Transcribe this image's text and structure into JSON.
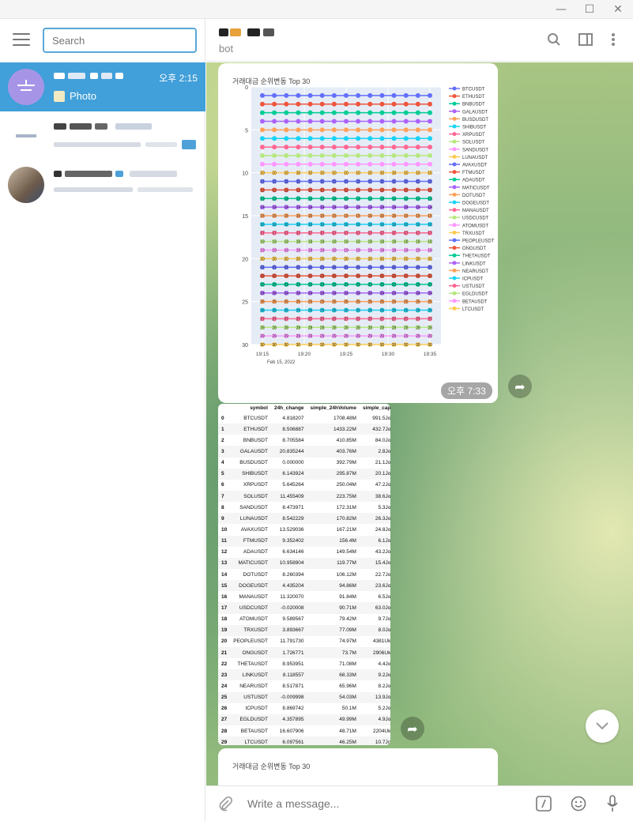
{
  "window": {
    "minimize_glyph": "—",
    "maximize_glyph": "☐",
    "close_glyph": "✕"
  },
  "sidebar": {
    "search_placeholder": "Search",
    "chats": [
      {
        "name_redacted": true,
        "time": "오후 2:15",
        "preview": "Photo",
        "preview_icon": "photo-icon",
        "active": true,
        "avatar_color": "#a695e7"
      },
      {
        "name_redacted": true,
        "time": "",
        "preview": "",
        "active": false
      },
      {
        "name_redacted": true,
        "time": "",
        "preview": "",
        "active": false
      }
    ]
  },
  "header": {
    "status": "bot"
  },
  "messages": {
    "chart_caption": "거래대금 순위변동 Top 30",
    "chart_time": "오후 7:33",
    "second_caption": "거래대금 순위변동 Top 30"
  },
  "table": {
    "columns": [
      "",
      "symbol",
      "24h_change",
      "simple_24hVolume",
      "simple_cap"
    ],
    "rows": [
      [
        "0",
        "BTCUSDT",
        "4.818207",
        "1708.48M",
        "991.5Jo"
      ],
      [
        "1",
        "ETHUSDT",
        "8.506887",
        "1433.22M",
        "432.7Jo"
      ],
      [
        "2",
        "BNBUSDT",
        "8.705584",
        "410.85M",
        "84.0Jo"
      ],
      [
        "3",
        "GALAUSDT",
        "20.835244",
        "403.76M",
        "2.8Jo"
      ],
      [
        "4",
        "BUSDUSDT",
        "0.000000",
        "392.79M",
        "21.1Jo"
      ],
      [
        "5",
        "SHIBUSDT",
        "6.143924",
        "295.87M",
        "20.1Jo"
      ],
      [
        "6",
        "XRPUSDT",
        "5.645264",
        "250.04M",
        "47.2Jo"
      ],
      [
        "7",
        "SOLUSDT",
        "11.455409",
        "223.75M",
        "38.6Jo"
      ],
      [
        "8",
        "SANDUSDT",
        "8.473971",
        "172.31M",
        "5.3Jo"
      ],
      [
        "9",
        "LUNAUSDT",
        "8.542229",
        "170.82M",
        "26.3Jo"
      ],
      [
        "10",
        "AVAXUSDT",
        "13.529036",
        "167.21M",
        "24.8Jo"
      ],
      [
        "11",
        "FTMUSDT",
        "9.352402",
        "156.4M",
        "6.1Jo"
      ],
      [
        "12",
        "ADAUSDT",
        "6.634146",
        "149.54M",
        "43.2Jo"
      ],
      [
        "13",
        "MATICUSDT",
        "10.958904",
        "119.77M",
        "15.4Jo"
      ],
      [
        "14",
        "DOTUSDT",
        "8.260394",
        "106.12M",
        "22.7Jo"
      ],
      [
        "15",
        "DOGEUSDT",
        "4.435204",
        "94.86M",
        "23.6Jo"
      ],
      [
        "16",
        "MANAUSDT",
        "11.320070",
        "91.84M",
        "6.5Jo"
      ],
      [
        "17",
        "USDCUSDT",
        "-0.020008",
        "90.71M",
        "63.0Jo"
      ],
      [
        "18",
        "ATOMUSDT",
        "9.589567",
        "79.42M",
        "9.7Jo"
      ],
      [
        "19",
        "TRXUSDT",
        "3.893667",
        "77.09M",
        "8.0Jo"
      ],
      [
        "20",
        "PEOPLEUSDT",
        "11.791730",
        "74.97M",
        "4381Uk"
      ],
      [
        "21",
        "ONGUSDT",
        "1.726771",
        "73.7M",
        "2906Uk"
      ],
      [
        "22",
        "THETAUSDT",
        "8.953951",
        "71.08M",
        "4.4Jo"
      ],
      [
        "23",
        "LINKUSDT",
        "8.118557",
        "68.33M",
        "9.2Jo"
      ],
      [
        "24",
        "NEARUSDT",
        "8.517871",
        "65.96M",
        "8.2Jo"
      ],
      [
        "25",
        "USTUSDT",
        "-0.009998",
        "54.03M",
        "13.9Jo"
      ],
      [
        "26",
        "ICPUSDT",
        "8.869742",
        "50.1M",
        "5.2Jo"
      ],
      [
        "27",
        "EGLDUSDT",
        "4.357895",
        "49.99M",
        "4.9Jo"
      ],
      [
        "28",
        "BETAUSDT",
        "16.607906",
        "48.71M",
        "2204Uk"
      ],
      [
        "29",
        "LTCUSDT",
        "6.097561",
        "46.25M",
        "10.7Jo"
      ]
    ]
  },
  "composer": {
    "placeholder": "Write a message..."
  },
  "chart_data": {
    "type": "line",
    "x": [
      "19:15",
      "19:20",
      "19:25",
      "19:30",
      "19:35"
    ],
    "x_sublabel": "Feb 15, 2022",
    "yticks": [
      0,
      5,
      10,
      15,
      20,
      25,
      30
    ],
    "ylim": [
      30,
      0
    ],
    "y_reversed": true,
    "legend_position": "right",
    "grid": true,
    "series": [
      {
        "name": "BTCUSDT",
        "rank": 1,
        "color": "#636efa"
      },
      {
        "name": "ETHUSDT",
        "rank": 2,
        "color": "#ef553b"
      },
      {
        "name": "BNBUSDT",
        "rank": 3,
        "color": "#00cc96"
      },
      {
        "name": "GALAUSDT",
        "rank": 4,
        "color": "#ab63fa"
      },
      {
        "name": "BUSDUSDT",
        "rank": 5,
        "color": "#ffa15a"
      },
      {
        "name": "SHIBUSDT",
        "rank": 6,
        "color": "#19d3f3"
      },
      {
        "name": "XRPUSDT",
        "rank": 7,
        "color": "#ff6692"
      },
      {
        "name": "SOLUSDT",
        "rank": 8,
        "color": "#b6e880"
      },
      {
        "name": "SANDUSDT",
        "rank": 9,
        "color": "#ff97ff"
      },
      {
        "name": "LUNAUSDT",
        "rank": 10,
        "color": "#fecb52"
      },
      {
        "name": "AVAXUSDT",
        "rank": 11,
        "color": "#636efa"
      },
      {
        "name": "FTMUSDT",
        "rank": 12,
        "color": "#ef553b"
      },
      {
        "name": "ADAUSDT",
        "rank": 13,
        "color": "#00cc96"
      },
      {
        "name": "MATICUSDT",
        "rank": 14,
        "color": "#ab63fa"
      },
      {
        "name": "DOTUSDT",
        "rank": 15,
        "color": "#ffa15a"
      },
      {
        "name": "DOGEUSDT",
        "rank": 16,
        "color": "#19d3f3"
      },
      {
        "name": "MANAUSDT",
        "rank": 17,
        "color": "#ff6692"
      },
      {
        "name": "USDCUSDT",
        "rank": 18,
        "color": "#b6e880"
      },
      {
        "name": "ATOMUSDT",
        "rank": 19,
        "color": "#ff97ff"
      },
      {
        "name": "TRXUSDT",
        "rank": 20,
        "color": "#fecb52"
      },
      {
        "name": "PEOPLEUSDT",
        "rank": 21,
        "color": "#636efa"
      },
      {
        "name": "ONGUSDT",
        "rank": 22,
        "color": "#ef553b"
      },
      {
        "name": "THETAUSDT",
        "rank": 23,
        "color": "#00cc96"
      },
      {
        "name": "LINKUSDT",
        "rank": 24,
        "color": "#ab63fa"
      },
      {
        "name": "NEARUSDT",
        "rank": 25,
        "color": "#ffa15a"
      },
      {
        "name": "ICPUSDT",
        "rank": 26,
        "color": "#19d3f3"
      },
      {
        "name": "USTUSDT",
        "rank": 27,
        "color": "#ff6692"
      },
      {
        "name": "EGLDUSDT",
        "rank": 28,
        "color": "#b6e880"
      },
      {
        "name": "BETAUSDT",
        "rank": 29,
        "color": "#ff97ff"
      },
      {
        "name": "LTCUSDT",
        "rank": 30,
        "color": "#fecb52"
      }
    ]
  }
}
